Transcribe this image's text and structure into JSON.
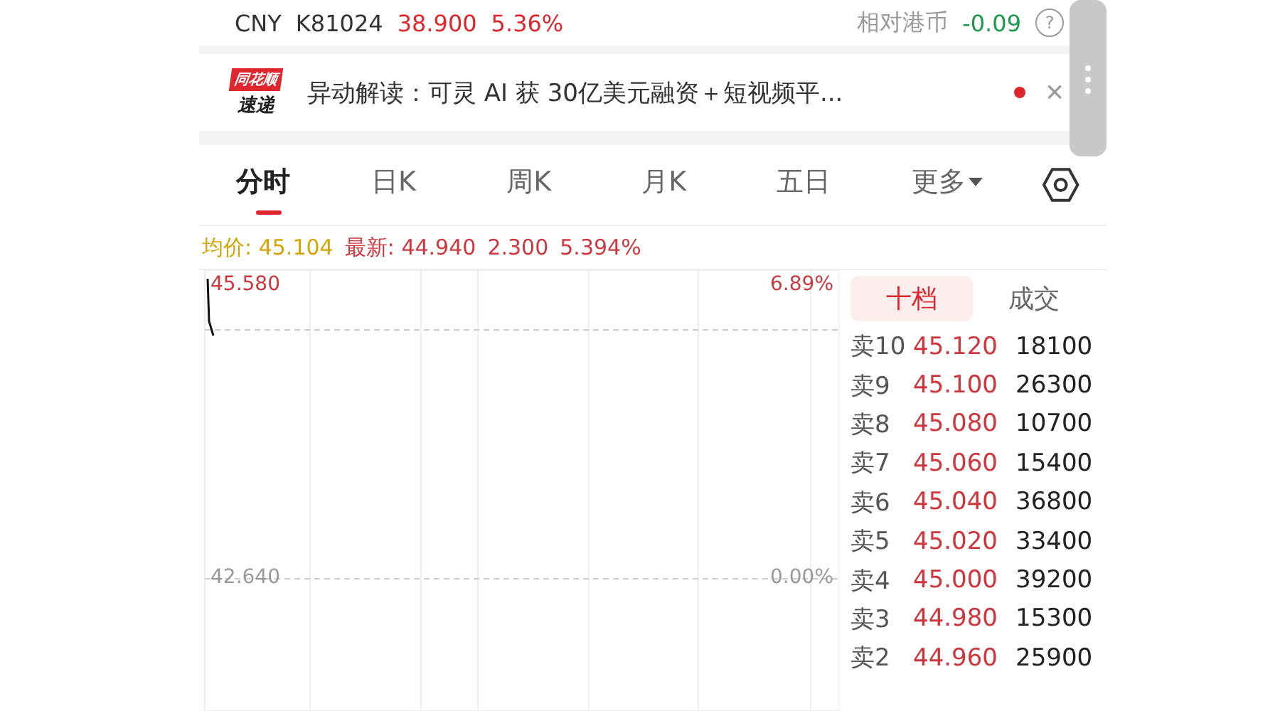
{
  "quote": {
    "currency": "CNY",
    "code": "K81024",
    "price": "38.900",
    "change_pct": "5.36%",
    "relative_label": "相对港币",
    "relative_value": "-0.09",
    "help": "?"
  },
  "news": {
    "badge_top": "同花顺",
    "badge_bottom": "速递",
    "text": "异动解读：可灵 AI 获 30亿美元融资＋短视频平...",
    "unread": true,
    "close": "×"
  },
  "tabs": [
    {
      "label": "分时",
      "selected": true,
      "kind": "tab"
    },
    {
      "label": "日K",
      "selected": false,
      "kind": "tab"
    },
    {
      "label": "周K",
      "selected": false,
      "kind": "tab"
    },
    {
      "label": "月K",
      "selected": false,
      "kind": "tab"
    },
    {
      "label": "五日",
      "selected": false,
      "kind": "tab"
    },
    {
      "label": "更多",
      "selected": false,
      "kind": "dropdown"
    }
  ],
  "summary": {
    "avg_label": "均价:",
    "avg": "45.104",
    "last_label": "最新:",
    "last": "44.940",
    "change": "2.300",
    "change_pct": "5.394%"
  },
  "chart": {
    "top_price": "45.580",
    "top_pct": "6.89%",
    "base_price": "42.640",
    "base_pct": "0.00%"
  },
  "book_tabs": [
    {
      "label": "十档",
      "selected": true
    },
    {
      "label": "成交",
      "selected": false
    }
  ],
  "asks": [
    {
      "level": "卖10",
      "price": "45.120",
      "volume": "18100"
    },
    {
      "level": "卖9",
      "price": "45.100",
      "volume": "26300"
    },
    {
      "level": "卖8",
      "price": "45.080",
      "volume": "10700"
    },
    {
      "level": "卖7",
      "price": "45.060",
      "volume": "15400"
    },
    {
      "level": "卖6",
      "price": "45.040",
      "volume": "36800"
    },
    {
      "level": "卖5",
      "price": "45.020",
      "volume": "33400"
    },
    {
      "level": "卖4",
      "price": "45.000",
      "volume": "39200"
    },
    {
      "level": "卖3",
      "price": "44.980",
      "volume": "15300"
    },
    {
      "level": "卖2",
      "price": "44.960",
      "volume": "25900"
    }
  ]
}
